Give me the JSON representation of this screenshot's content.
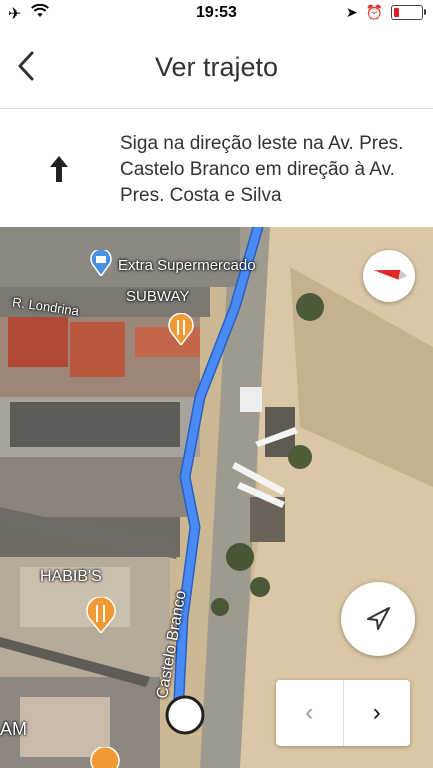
{
  "status": {
    "time": "19:53"
  },
  "header": {
    "title": "Ver trajeto",
    "back_icon": "chevron-left-icon"
  },
  "instruction": {
    "text": "Siga na direção leste na Av. Pres. Castelo Branco em direção à Av. Pres. Costa e Silva",
    "icon": "arrow-up-icon"
  },
  "map": {
    "labels": {
      "extra": "Extra Supermercado",
      "subway": "SUBWAY",
      "londrina": "R. Londrina",
      "habibs": "HABIB'S",
      "street": "Castelo Branco",
      "am": "AM"
    },
    "route_color": "#4a8af4",
    "pin_blue": "#4a90e2",
    "pin_orange": "#f09a36"
  },
  "controls": {
    "compass_icon": "compass-icon",
    "locate_icon": "navigation-arrow-icon",
    "prev_label": "‹",
    "next_label": "›"
  }
}
